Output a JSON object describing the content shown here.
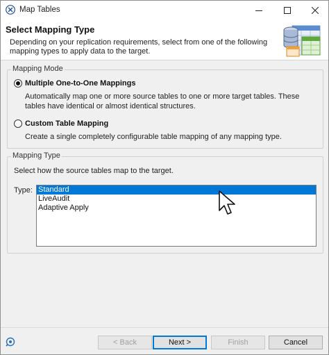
{
  "window": {
    "title": "Map Tables",
    "icon": "map-tables-app-icon"
  },
  "banner": {
    "title": "Select Mapping Type",
    "description": "Depending on your replication requirements, select from one of the following mapping types to apply data to the target.",
    "icon": "database-tables-icon"
  },
  "mapping_mode": {
    "label": "Mapping Mode",
    "options": [
      {
        "label": "Multiple One-to-One Mappings",
        "description": "Automatically map one or more source tables to one or more target tables. These tables have identical or almost identical structures.",
        "checked": true
      },
      {
        "label": "Custom Table Mapping",
        "description": "Create a single completely configurable table mapping of any mapping type.",
        "checked": false
      }
    ]
  },
  "mapping_type": {
    "label": "Mapping Type",
    "description": "Select how the source tables map to the target.",
    "type_label": "Type:",
    "items": [
      "Standard",
      "LiveAudit",
      "Adaptive Apply"
    ],
    "selected": "Standard"
  },
  "footer": {
    "back": "< Back",
    "next": "Next >",
    "finish": "Finish",
    "cancel": "Cancel"
  },
  "colors": {
    "selection": "#0078d7",
    "default_button_border": "#0078d7"
  }
}
